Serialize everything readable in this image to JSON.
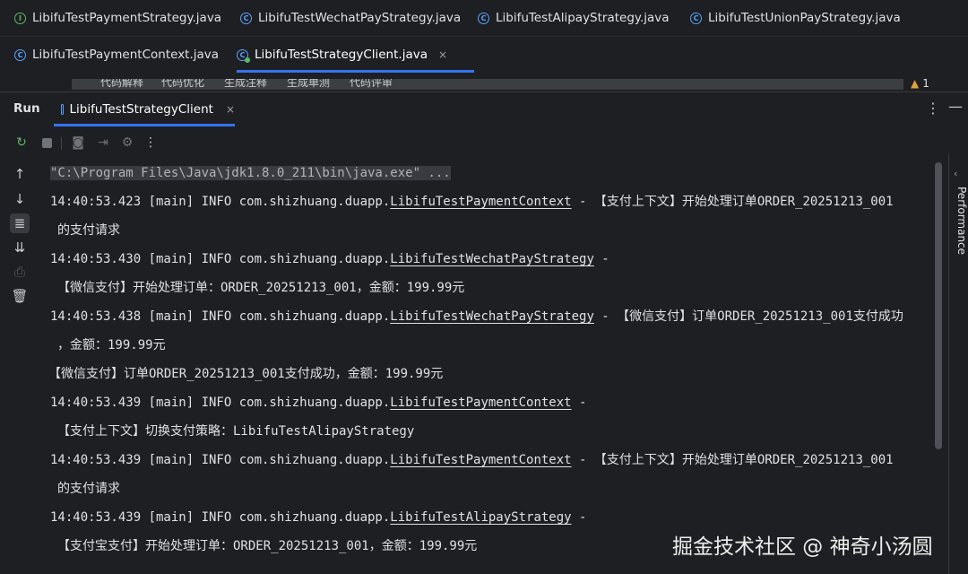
{
  "editor_tabs_row1": [
    {
      "label": "LibifuTestPaymentStrategy.java",
      "icon": "interface-icon"
    },
    {
      "label": "LibifuTestWechatPayStrategy.java",
      "icon": "class-icon"
    },
    {
      "label": "LibifuTestAlipayStrategy.java",
      "icon": "class-icon"
    },
    {
      "label": "LibifuTestUnionPayStrategy.java",
      "icon": "class-icon"
    }
  ],
  "editor_tabs_row2": [
    {
      "label": "LibifuTestPaymentContext.java",
      "icon": "class-icon"
    },
    {
      "label": "LibifuTestStrategyClient.java",
      "icon": "runnable-class-icon",
      "active": true
    }
  ],
  "close_glyph": "×",
  "strip_items": [
    "代码解释",
    "代码优化",
    "生成注释",
    "生成单测",
    "代码评审"
  ],
  "warnings": {
    "count": "1"
  },
  "run": {
    "label": "Run",
    "tab_label": "LibifuTestStrategyClient"
  },
  "console": {
    "command": "\"C:\\Program Files\\Java\\jdk1.8.0_211\\bin\\java.exe\" ...",
    "logs": [
      {
        "prefix": "14:40:53.423 [main] INFO com.shizhuang.duapp.",
        "cls": "LibifuTestPaymentContext",
        "suffix": " - 【支付上下文】开始处理订单ORDER_20251213_001",
        "cont": "的支付请求"
      },
      {
        "prefix": "14:40:53.430 [main] INFO com.shizhuang.duapp.",
        "cls": "LibifuTestWechatPayStrategy",
        "suffix": " -",
        "cont": "【微信支付】开始处理订单：ORDER_20251213_001，金额：199.99元"
      },
      {
        "prefix": "14:40:53.438 [main] INFO com.shizhuang.duapp.",
        "cls": "LibifuTestWechatPayStrategy",
        "suffix": " - 【微信支付】订单ORDER_20251213_001支付成功",
        "cont": "，金额：199.99元"
      },
      {
        "plain": "【微信支付】订单ORDER_20251213_001支付成功，金额：199.99元"
      },
      {
        "prefix": "14:40:53.439 [main] INFO com.shizhuang.duapp.",
        "cls": "LibifuTestPaymentContext",
        "suffix": " -",
        "cont": "【支付上下文】切换支付策略：LibifuTestAlipayStrategy"
      },
      {
        "prefix": "14:40:53.439 [main] INFO com.shizhuang.duapp.",
        "cls": "LibifuTestPaymentContext",
        "suffix": " - 【支付上下文】开始处理订单ORDER_20251213_001",
        "cont": "的支付请求"
      },
      {
        "prefix": "14:40:53.439 [main] INFO com.shizhuang.duapp.",
        "cls": "LibifuTestAlipayStrategy",
        "suffix": " -",
        "cont": "【支付宝支付】开始处理订单：ORDER_20251213_001，金额：199.99元"
      }
    ]
  },
  "right_panel": {
    "label": "Performance"
  },
  "watermark": "掘金技术社区 @ 神奇小汤圆",
  "colors": {
    "accent": "#3574f0",
    "background": "#1e1f22",
    "class_icon": "#5aa3ff",
    "interface_icon": "#5fb865"
  }
}
